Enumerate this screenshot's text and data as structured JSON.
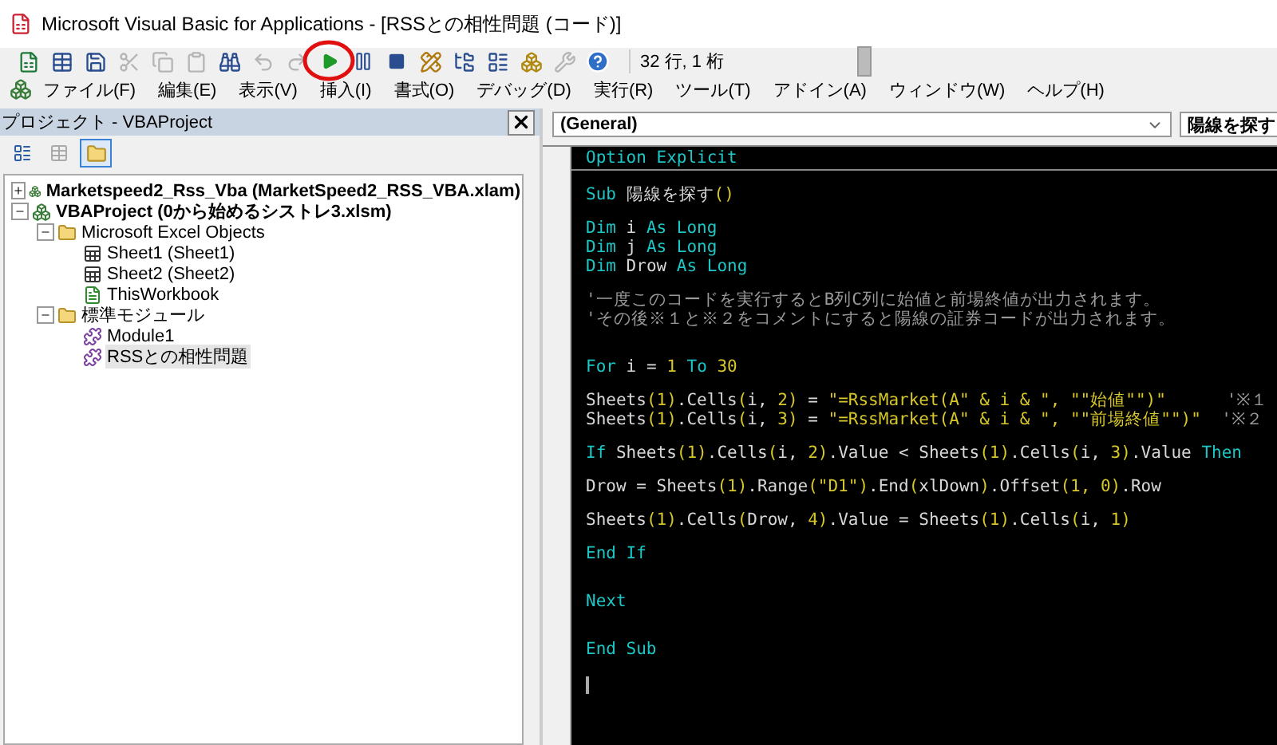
{
  "window": {
    "title": "Microsoft Visual Basic for Applications - [RSSとの相性問題 (コード)]"
  },
  "toolbar": {
    "buttons": [
      {
        "kind": "excel",
        "disabled": false
      },
      {
        "kind": "insert",
        "disabled": false
      },
      {
        "kind": "save",
        "disabled": false
      },
      {
        "kind": "cut",
        "disabled": true
      },
      {
        "kind": "copy",
        "disabled": true
      },
      {
        "kind": "paste",
        "disabled": true
      },
      {
        "kind": "find",
        "disabled": false
      },
      {
        "kind": "undo",
        "disabled": true
      },
      {
        "kind": "redo",
        "disabled": true
      },
      {
        "kind": "run",
        "disabled": false,
        "highlighted": true
      },
      {
        "kind": "pause",
        "disabled": false
      },
      {
        "kind": "stop",
        "disabled": false
      },
      {
        "kind": "design",
        "disabled": false
      },
      {
        "kind": "explorer",
        "disabled": false
      },
      {
        "kind": "properties",
        "disabled": false
      },
      {
        "kind": "browser",
        "disabled": false
      },
      {
        "kind": "tools",
        "disabled": true
      },
      {
        "kind": "help",
        "disabled": false
      }
    ],
    "position": "32 行, 1 桁"
  },
  "menu": [
    "ファイル(F)",
    "編集(E)",
    "表示(V)",
    "挿入(I)",
    "書式(O)",
    "デバッグ(D)",
    "実行(R)",
    "ツール(T)",
    "アドイン(A)",
    "ウィンドウ(W)",
    "ヘルプ(H)"
  ],
  "project_panel": {
    "title": "プロジェクト - VBAProject",
    "view_buttons": [
      {
        "kind": "code",
        "selected": false
      },
      {
        "kind": "object",
        "selected": false
      },
      {
        "kind": "folders",
        "selected": true
      }
    ],
    "tree": [
      {
        "label": "Marketspeed2_Rss_Vba (MarketSpeed2_RSS_VBA.xlam)",
        "kind": "project",
        "expanded": false
      },
      {
        "label": "VBAProject (0から始めるシストレ3.xlsm)",
        "kind": "project",
        "expanded": true,
        "children": [
          {
            "label": "Microsoft Excel Objects",
            "kind": "folder",
            "expanded": true,
            "children": [
              {
                "label": "Sheet1 (Sheet1)",
                "kind": "sheet"
              },
              {
                "label": "Sheet2 (Sheet2)",
                "kind": "sheet"
              },
              {
                "label": "ThisWorkbook",
                "kind": "workbook"
              }
            ]
          },
          {
            "label": "標準モジュール",
            "kind": "folder",
            "expanded": true,
            "children": [
              {
                "label": "Module1",
                "kind": "module",
                "selected": false
              },
              {
                "label": "RSSとの相性問題",
                "kind": "module",
                "selected": true
              }
            ]
          }
        ]
      }
    ]
  },
  "code_window": {
    "object_combo": "(General)",
    "procedure_combo": "陽線を探す",
    "lines": [
      {
        "kind": "code",
        "segments": [
          {
            "kind": "keyword",
            "text": "Option Explicit"
          }
        ]
      },
      {
        "kind": "separator"
      },
      {
        "kind": "blank"
      },
      {
        "kind": "code",
        "segments": [
          {
            "kind": "keyword",
            "text": "Sub "
          },
          {
            "kind": "plain",
            "text": "陽線を探す"
          },
          {
            "kind": "literal",
            "text": "()"
          }
        ]
      },
      {
        "kind": "blank"
      },
      {
        "kind": "code",
        "segments": [
          {
            "kind": "keyword",
            "text": "Dim "
          },
          {
            "kind": "plain",
            "text": "i "
          },
          {
            "kind": "keyword",
            "text": "As Long"
          }
        ]
      },
      {
        "kind": "code",
        "segments": [
          {
            "kind": "keyword",
            "text": "Dim "
          },
          {
            "kind": "plain",
            "text": "j "
          },
          {
            "kind": "keyword",
            "text": "As Long"
          }
        ]
      },
      {
        "kind": "code",
        "segments": [
          {
            "kind": "keyword",
            "text": "Dim "
          },
          {
            "kind": "plain",
            "text": "Drow "
          },
          {
            "kind": "keyword",
            "text": "As Long"
          }
        ]
      },
      {
        "kind": "blank"
      },
      {
        "kind": "code",
        "segments": [
          {
            "kind": "comment",
            "text": "'一度このコードを実行するとB列C列に始値と前場終値が出力されます。"
          }
        ]
      },
      {
        "kind": "code",
        "segments": [
          {
            "kind": "comment",
            "text": "'その後※１と※２をコメントにすると陽線の証券コードが出力されます。"
          }
        ]
      },
      {
        "kind": "blank"
      },
      {
        "kind": "blank"
      },
      {
        "kind": "code",
        "segments": [
          {
            "kind": "keyword",
            "text": "For "
          },
          {
            "kind": "plain",
            "text": "i = "
          },
          {
            "kind": "literal",
            "text": "1"
          },
          {
            "kind": "keyword",
            "text": " To "
          },
          {
            "kind": "literal",
            "text": "30"
          }
        ]
      },
      {
        "kind": "blank"
      },
      {
        "kind": "code",
        "segments": [
          {
            "kind": "plain",
            "text": "Sheets"
          },
          {
            "kind": "literal",
            "text": "(1)"
          },
          {
            "kind": "plain",
            "text": ".Cells"
          },
          {
            "kind": "literal",
            "text": "("
          },
          {
            "kind": "plain",
            "text": "i, "
          },
          {
            "kind": "literal",
            "text": "2)"
          },
          {
            "kind": "plain",
            "text": " = "
          },
          {
            "kind": "literal",
            "text": "\"=RssMarket(A\" & i & \", \"\"始値\"\")\"      "
          },
          {
            "kind": "comment",
            "text": "'※１"
          }
        ]
      },
      {
        "kind": "code",
        "segments": [
          {
            "kind": "plain",
            "text": "Sheets"
          },
          {
            "kind": "literal",
            "text": "(1)"
          },
          {
            "kind": "plain",
            "text": ".Cells"
          },
          {
            "kind": "literal",
            "text": "("
          },
          {
            "kind": "plain",
            "text": "i, "
          },
          {
            "kind": "literal",
            "text": "3)"
          },
          {
            "kind": "plain",
            "text": " = "
          },
          {
            "kind": "literal",
            "text": "\"=RssMarket(A\" & i & \", \"\"前場終値\"\")\"  "
          },
          {
            "kind": "comment",
            "text": "'※２"
          }
        ]
      },
      {
        "kind": "blank"
      },
      {
        "kind": "code",
        "segments": [
          {
            "kind": "keyword",
            "text": "If "
          },
          {
            "kind": "plain",
            "text": "Sheets"
          },
          {
            "kind": "literal",
            "text": "(1)"
          },
          {
            "kind": "plain",
            "text": ".Cells"
          },
          {
            "kind": "literal",
            "text": "("
          },
          {
            "kind": "plain",
            "text": "i, "
          },
          {
            "kind": "literal",
            "text": "2)"
          },
          {
            "kind": "plain",
            "text": ".Value < Sheets"
          },
          {
            "kind": "literal",
            "text": "(1)"
          },
          {
            "kind": "plain",
            "text": ".Cells"
          },
          {
            "kind": "literal",
            "text": "("
          },
          {
            "kind": "plain",
            "text": "i, "
          },
          {
            "kind": "literal",
            "text": "3)"
          },
          {
            "kind": "plain",
            "text": ".Value "
          },
          {
            "kind": "keyword",
            "text": "Then"
          }
        ]
      },
      {
        "kind": "blank"
      },
      {
        "kind": "code",
        "segments": [
          {
            "kind": "plain",
            "text": "Drow = Sheets"
          },
          {
            "kind": "literal",
            "text": "(1)"
          },
          {
            "kind": "plain",
            "text": ".Range"
          },
          {
            "kind": "literal",
            "text": "(\"D1\")"
          },
          {
            "kind": "plain",
            "text": ".End"
          },
          {
            "kind": "literal",
            "text": "("
          },
          {
            "kind": "plain",
            "text": "xlDown"
          },
          {
            "kind": "literal",
            "text": ")"
          },
          {
            "kind": "plain",
            "text": ".Offset"
          },
          {
            "kind": "literal",
            "text": "(1, 0)"
          },
          {
            "kind": "plain",
            "text": ".Row"
          }
        ]
      },
      {
        "kind": "blank"
      },
      {
        "kind": "code",
        "segments": [
          {
            "kind": "plain",
            "text": "Sheets"
          },
          {
            "kind": "literal",
            "text": "(1)"
          },
          {
            "kind": "plain",
            "text": ".Cells"
          },
          {
            "kind": "literal",
            "text": "("
          },
          {
            "kind": "plain",
            "text": "Drow, "
          },
          {
            "kind": "literal",
            "text": "4)"
          },
          {
            "kind": "plain",
            "text": ".Value = Sheets"
          },
          {
            "kind": "literal",
            "text": "(1)"
          },
          {
            "kind": "plain",
            "text": ".Cells"
          },
          {
            "kind": "literal",
            "text": "("
          },
          {
            "kind": "plain",
            "text": "i, "
          },
          {
            "kind": "literal",
            "text": "1)"
          }
        ]
      },
      {
        "kind": "blank"
      },
      {
        "kind": "code",
        "segments": [
          {
            "kind": "keyword",
            "text": "End If"
          }
        ]
      },
      {
        "kind": "blank"
      },
      {
        "kind": "blank"
      },
      {
        "kind": "code",
        "segments": [
          {
            "kind": "keyword",
            "text": "Next"
          }
        ]
      },
      {
        "kind": "blank"
      },
      {
        "kind": "blank"
      },
      {
        "kind": "code",
        "segments": [
          {
            "kind": "keyword",
            "text": "End Sub"
          }
        ]
      },
      {
        "kind": "blank"
      },
      {
        "kind": "cursor"
      }
    ]
  }
}
